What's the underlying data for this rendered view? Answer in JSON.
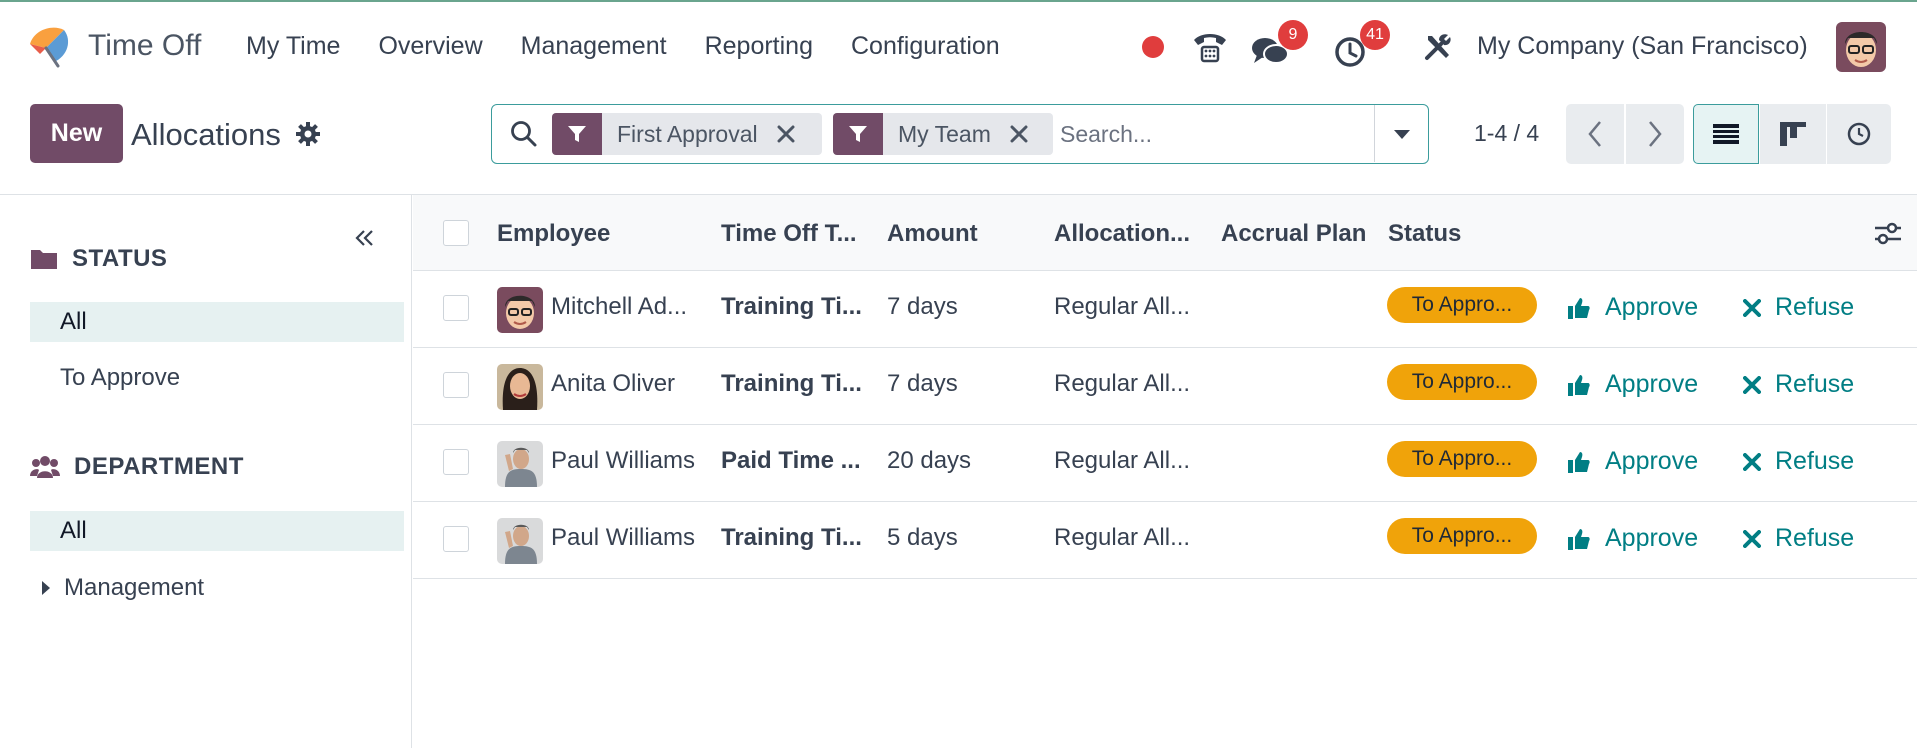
{
  "app": {
    "name": "Time Off"
  },
  "menu": [
    {
      "label": "My Time"
    },
    {
      "label": "Overview"
    },
    {
      "label": "Management"
    },
    {
      "label": "Reporting"
    },
    {
      "label": "Configuration"
    }
  ],
  "systray": {
    "messages_count": "9",
    "activities_count": "41",
    "company": "My Company (San Francisco)"
  },
  "control": {
    "new_label": "New",
    "title": "Allocations",
    "facets": [
      {
        "label": "First Approval"
      },
      {
        "label": "My Team"
      }
    ],
    "search_placeholder": "Search...",
    "pager": "1-4 / 4"
  },
  "sidebar": {
    "status": {
      "title": "STATUS",
      "items": [
        {
          "label": "All"
        },
        {
          "label": "To Approve"
        }
      ]
    },
    "department": {
      "title": "DEPARTMENT",
      "items": [
        {
          "label": "All"
        },
        {
          "label": "Management"
        }
      ]
    }
  },
  "table": {
    "columns": [
      "Employee",
      "Time Off T...",
      "Amount",
      "Allocation...",
      "Accrual Plan",
      "Status"
    ],
    "approve_label": "Approve",
    "refuse_label": "Refuse",
    "rows": [
      {
        "employee": "Mitchell Ad...",
        "type": "Training Ti...",
        "amount": "7 days",
        "allocation": "Regular All...",
        "accrual": "",
        "status": "To Appro..."
      },
      {
        "employee": "Anita Oliver",
        "type": "Training Ti...",
        "amount": "7 days",
        "allocation": "Regular All...",
        "accrual": "",
        "status": "To Appro..."
      },
      {
        "employee": "Paul Williams",
        "type": "Paid Time ...",
        "amount": "20 days",
        "allocation": "Regular All...",
        "accrual": "",
        "status": "To Appro..."
      },
      {
        "employee": "Paul Williams",
        "type": "Training Ti...",
        "amount": "5 days",
        "allocation": "Regular All...",
        "accrual": "",
        "status": "To Appro..."
      }
    ]
  },
  "colors": {
    "brand": "#714b67",
    "accent": "#017e84",
    "status_badge": "#f0a30a",
    "notification": "#e03d3d"
  }
}
